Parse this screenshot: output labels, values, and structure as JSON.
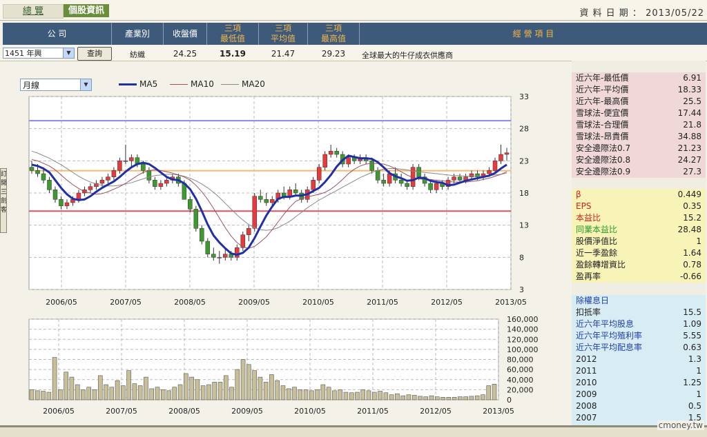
{
  "tabs": {
    "overview": "總 覽",
    "stock_info": "個股資訊"
  },
  "date_label": "資 料 日 期 ： 2013/05/22",
  "header": {
    "company": "公 司",
    "industry": "產業別",
    "close": "收盤價",
    "min3a": "三項",
    "min3b": "最低值",
    "avg3a": "三項",
    "avg3b": "平均值",
    "max3a": "三項",
    "max3b": "最高值",
    "business": "經 營 項 目"
  },
  "row": {
    "company_select": "1451 年興",
    "query_button": "查詢",
    "industry": "紡織",
    "close": "24.25",
    "min3": "15.19",
    "avg3": "21.47",
    "max3": "29.23",
    "business": "全球最大的牛仔成衣供應商"
  },
  "side_tab_label": "訂閱三劍客",
  "period_select": "月線",
  "legend": {
    "ma5": "MA5",
    "ma10": "MA10",
    "ma20": "MA20"
  },
  "colors": {
    "up": "#e8393d",
    "down": "#3c9a2e",
    "ma5": "#1f2fa8",
    "ma10": "#a05060",
    "ma20": "#8a8a8a",
    "line_high": "#8888ee",
    "line_mid": "#f4b870",
    "line_low": "#e05060",
    "vol": "#c8bf98"
  },
  "chart_data": [
    {
      "type": "candlestick",
      "x_ticks": [
        "2006/05",
        "2007/05",
        "2008/05",
        "2009/05",
        "2010/05",
        "2011/05",
        "2012/05",
        "2013/05"
      ],
      "y_ticks": [
        33,
        28,
        23,
        18,
        13,
        8,
        3
      ],
      "ylim": [
        3,
        33
      ],
      "horizontal_lines": [
        29.23,
        21.47,
        15.19
      ],
      "ohlc": [
        [
          22,
          23,
          21,
          21.5
        ],
        [
          21.5,
          22.5,
          20.5,
          21
        ],
        [
          21,
          22,
          19.5,
          20
        ],
        [
          20,
          20.5,
          18,
          18.5
        ],
        [
          18.5,
          19,
          16.5,
          17
        ],
        [
          17,
          17.5,
          15.5,
          16
        ],
        [
          16,
          17,
          15.5,
          16.5
        ],
        [
          16.5,
          17.5,
          16,
          17
        ],
        [
          17,
          18.5,
          16.5,
          18
        ],
        [
          18,
          19,
          17.5,
          18.5
        ],
        [
          18.5,
          19.5,
          18,
          19
        ],
        [
          19,
          20,
          18.5,
          19.5
        ],
        [
          19.5,
          20.5,
          19,
          20
        ],
        [
          20,
          21,
          19.5,
          20.5
        ],
        [
          20.5,
          22,
          20,
          21.5
        ],
        [
          21.5,
          23.5,
          21,
          23
        ],
        [
          23,
          25.5,
          22.5,
          23
        ],
        [
          23,
          24,
          22,
          23.5
        ],
        [
          23.5,
          24,
          22,
          22.5
        ],
        [
          22.5,
          23,
          21,
          21.5
        ],
        [
          21.5,
          22,
          19.5,
          20
        ],
        [
          20,
          20.5,
          18.5,
          19
        ],
        [
          19,
          20,
          18.5,
          19.5
        ],
        [
          19.5,
          20.5,
          19,
          20
        ],
        [
          20,
          21,
          19.5,
          20.5
        ],
        [
          20.5,
          21,
          19,
          19.5
        ],
        [
          19.5,
          20,
          17,
          17
        ],
        [
          17,
          17.5,
          15,
          15.5
        ],
        [
          15.5,
          16,
          12,
          12.5
        ],
        [
          12.5,
          13,
          10,
          10.5
        ],
        [
          10.5,
          11,
          8,
          8.5
        ],
        [
          8.5,
          9.5,
          7.5,
          8
        ],
        [
          8,
          9,
          7,
          8
        ],
        [
          8,
          9.5,
          7.5,
          8.5
        ],
        [
          8.5,
          9,
          7.5,
          8
        ],
        [
          8,
          10,
          7.5,
          9.5
        ],
        [
          9.5,
          12,
          9,
          11.5
        ],
        [
          11.5,
          13,
          10.5,
          12.5
        ],
        [
          12.5,
          18,
          12,
          17.5
        ],
        [
          17.5,
          18.5,
          16.5,
          17
        ],
        [
          17,
          18,
          16,
          16.5
        ],
        [
          16.5,
          17.5,
          16,
          17
        ],
        [
          17,
          18.5,
          16.5,
          18
        ],
        [
          18,
          19,
          17,
          17.5
        ],
        [
          17.5,
          19,
          17,
          18.5
        ],
        [
          18.5,
          19.5,
          17.5,
          18
        ],
        [
          18,
          18.5,
          16.5,
          17
        ],
        [
          17,
          19,
          16.5,
          18.5
        ],
        [
          18.5,
          20.5,
          18,
          20
        ],
        [
          20,
          22.5,
          19.5,
          22
        ],
        [
          22,
          24.5,
          21.5,
          24
        ],
        [
          24,
          25.5,
          23.5,
          24.5
        ],
        [
          24.5,
          25,
          23.5,
          24
        ],
        [
          24,
          24.5,
          22,
          22.5
        ],
        [
          22.5,
          24,
          22,
          23.5
        ],
        [
          23.5,
          24,
          22.5,
          23
        ],
        [
          23,
          24,
          22.5,
          23.5
        ],
        [
          23.5,
          24,
          22.5,
          23
        ],
        [
          23,
          23.5,
          21,
          21.5
        ],
        [
          21.5,
          22,
          19.5,
          20
        ],
        [
          20,
          21,
          19,
          19.5
        ],
        [
          19.5,
          21.5,
          19,
          21
        ],
        [
          21,
          22,
          19.5,
          20
        ],
        [
          20,
          21,
          19,
          19.5
        ],
        [
          19.5,
          20,
          18.5,
          19
        ],
        [
          19,
          22.5,
          18.5,
          22
        ],
        [
          22,
          22.5,
          20,
          20.5
        ],
        [
          20.5,
          21,
          19,
          19.5
        ],
        [
          19.5,
          20,
          18,
          18.5
        ],
        [
          18.5,
          20,
          18,
          19.5
        ],
        [
          19.5,
          20,
          18.5,
          19
        ],
        [
          19,
          20.5,
          18.5,
          20
        ],
        [
          20,
          21,
          19.5,
          20.5
        ],
        [
          20.5,
          21,
          19.5,
          20
        ],
        [
          20,
          21,
          19.5,
          20.5
        ],
        [
          20.5,
          21.5,
          20,
          21
        ],
        [
          21,
          21.5,
          20,
          20.5
        ],
        [
          20.5,
          21.5,
          20,
          21
        ],
        [
          21,
          22,
          20.5,
          21.5
        ],
        [
          21.5,
          23.5,
          21,
          23
        ],
        [
          23,
          25.5,
          22.5,
          24
        ],
        [
          24,
          25,
          23,
          24.25
        ]
      ],
      "ma5": [
        22.4,
        22.2,
        21.8,
        21.2,
        20,
        18.8,
        17.8,
        17.1,
        16.9,
        17,
        17.5,
        18.2,
        18.8,
        19.3,
        19.8,
        20.5,
        21.3,
        22,
        22.5,
        22.7,
        22.5,
        21.9,
        21.2,
        20.5,
        20.1,
        20,
        19.5,
        18.6,
        17.1,
        15.2,
        13.1,
        11.4,
        10.3,
        9.4,
        8.6,
        8.4,
        8.7,
        9.5,
        11,
        12.8,
        14.5,
        15.9,
        17.1,
        17.4,
        17.4,
        17.6,
        17.6,
        17.8,
        18.3,
        18.8,
        19.7,
        20.8,
        22.1,
        23.1,
        23.8,
        23.6,
        23.4,
        23.4,
        23.3,
        22.8,
        22,
        21.1,
        20.6,
        20.3,
        19.9,
        20,
        20.4,
        20.3,
        19.9,
        19.7,
        19.6,
        19.2,
        19.3,
        19.6,
        19.9,
        20.1,
        20.3,
        20.5,
        20.7,
        21.1,
        21.8,
        22.4
      ],
      "ma10": [
        23.2,
        23,
        22.6,
        22.2,
        21.6,
        20.8,
        20,
        19.3,
        18.7,
        18.2,
        18,
        17.8,
        17.9,
        18.2,
        18.6,
        19,
        19.5,
        20.1,
        20.7,
        21.2,
        21.5,
        21.6,
        21.5,
        21.3,
        21.1,
        20.8,
        20.5,
        20,
        19.2,
        18.2,
        17,
        15.6,
        14.1,
        12.6,
        11.3,
        10.3,
        9.6,
        9.4,
        9.7,
        10.4,
        11.2,
        12.3,
        13.5,
        14.7,
        15.8,
        16.7,
        17.1,
        17.4,
        17.6,
        17.8,
        18.1,
        18.6,
        19.3,
        20.1,
        21,
        21.7,
        22.2,
        22.5,
        22.6,
        22.6,
        22.5,
        22.2,
        21.8,
        21.3,
        20.8,
        20.4,
        20.2,
        20.1,
        20.1,
        20,
        19.9,
        19.8,
        19.7,
        19.7,
        19.7,
        19.8,
        19.9,
        20.1,
        20.3,
        20.6,
        20.9,
        21.3
      ],
      "ma20": [
        24.5,
        24.2,
        23.8,
        23.4,
        22.9,
        22.4,
        21.8,
        21.2,
        20.6,
        20.1,
        19.7,
        19.4,
        19.2,
        19.1,
        19.1,
        19.2,
        19.4,
        19.6,
        19.9,
        20.2,
        20.5,
        20.7,
        20.8,
        20.9,
        20.9,
        20.8,
        20.6,
        20.3,
        19.9,
        19.4,
        18.8,
        18.1,
        17.3,
        16.4,
        15.5,
        14.6,
        13.8,
        13.1,
        12.6,
        12.3,
        12.2,
        12.3,
        12.6,
        13.1,
        13.6,
        14.3,
        15,
        15.7,
        16.3,
        16.9,
        17.4,
        17.9,
        18.4,
        18.9,
        19.4,
        19.9,
        20.4,
        20.8,
        21.2,
        21.5,
        21.7,
        21.8,
        21.8,
        21.7,
        21.6,
        21.4,
        21.3,
        21.2,
        21.1,
        21,
        20.9,
        20.8,
        20.7,
        20.7,
        20.6,
        20.6,
        20.6,
        20.6,
        20.7,
        20.8,
        20.9,
        21.1
      ]
    },
    {
      "type": "bar",
      "x_ticks": [
        "2006/05",
        "2007/05",
        "2008/05",
        "2009/05",
        "2010/05",
        "2011/05",
        "2012/05",
        "2013/05"
      ],
      "y_ticks": [
        "160,000",
        "140,000",
        "120,000",
        "100,000",
        "80,000",
        "60,000",
        "40,000",
        "20,000",
        "0"
      ],
      "ylim": [
        0,
        160000
      ],
      "values": [
        20000,
        18000,
        17000,
        15000,
        84000,
        20000,
        55000,
        45000,
        30000,
        20000,
        25000,
        20000,
        48000,
        30000,
        25000,
        38000,
        28000,
        58000,
        32000,
        28000,
        45000,
        22000,
        25000,
        20000,
        18000,
        25000,
        30000,
        52000,
        45000,
        40000,
        28000,
        30000,
        35000,
        35000,
        48000,
        25000,
        60000,
        80000,
        70000,
        58000,
        45000,
        35000,
        50000,
        38000,
        28000,
        22000,
        25000,
        20000,
        20000,
        18000,
        20000,
        30000,
        25000,
        18000,
        20000,
        15000,
        14000,
        15000,
        20000,
        18000,
        15000,
        17000,
        14000,
        10000,
        12000,
        8000,
        10000,
        9000,
        7000,
        6000,
        8000,
        6000,
        5000,
        5000,
        5000,
        6000,
        6000,
        7000,
        8000,
        10000,
        28000,
        31000
      ]
    }
  ],
  "right_panel": {
    "group1": [
      {
        "label": "近六年-最低價",
        "value": "6.91"
      },
      {
        "label": "近六年-平均價",
        "value": "18.33"
      },
      {
        "label": "近六年-最高價",
        "value": "25.5"
      },
      {
        "label": "雪球法-便宜價",
        "value": "17.44"
      },
      {
        "label": "雪球法-合理價",
        "value": "21.8"
      },
      {
        "label": "雪球法-昂貴價",
        "value": "34.88"
      },
      {
        "label": "安全邊際法0.7",
        "value": "21.23"
      },
      {
        "label": "安全邊際法0.8",
        "value": "24.27"
      },
      {
        "label": "安全邊際法0.9",
        "value": "27.3"
      }
    ],
    "group2": [
      {
        "label": "β",
        "value": "0.449",
        "color": "#d02020"
      },
      {
        "label": "EPS",
        "value": "0.35",
        "color": "#d02020"
      },
      {
        "label": "本益比",
        "value": "15.2",
        "color": "#d02020"
      },
      {
        "label": "同業本益比",
        "value": "28.48",
        "color": "#2a9a2a"
      },
      {
        "label": "股價淨值比",
        "value": "1",
        "color": "#222222"
      },
      {
        "label": "近一季盈餘",
        "value": "1.64",
        "color": "#222222"
      },
      {
        "label": "盈餘轉增資比",
        "value": "0.78",
        "color": "#222222"
      },
      {
        "label": "盈再率",
        "value": "-0.66",
        "color": "#222222"
      }
    ],
    "group3_title": "除權息日",
    "group3": [
      {
        "label": "扣抵率",
        "value": "15.5",
        "color": "#222222"
      },
      {
        "label": "近六年平均股息",
        "value": "1.09",
        "color": "#2040b0"
      },
      {
        "label": "近六年平均殖利率",
        "value": "5.55",
        "color": "#2040b0"
      },
      {
        "label": "近六年平均配息率",
        "value": "0.63",
        "color": "#2040b0"
      },
      {
        "label": "2012",
        "value": "1.3",
        "color": "#222222"
      },
      {
        "label": "2011",
        "value": "1",
        "color": "#222222"
      },
      {
        "label": "2010",
        "value": "1.25",
        "color": "#222222"
      },
      {
        "label": "2009",
        "value": "1",
        "color": "#222222"
      },
      {
        "label": "2008",
        "value": "0.5",
        "color": "#222222"
      },
      {
        "label": "2007",
        "value": "1.5",
        "color": "#222222"
      }
    ]
  },
  "brand": "cmoney.tw"
}
